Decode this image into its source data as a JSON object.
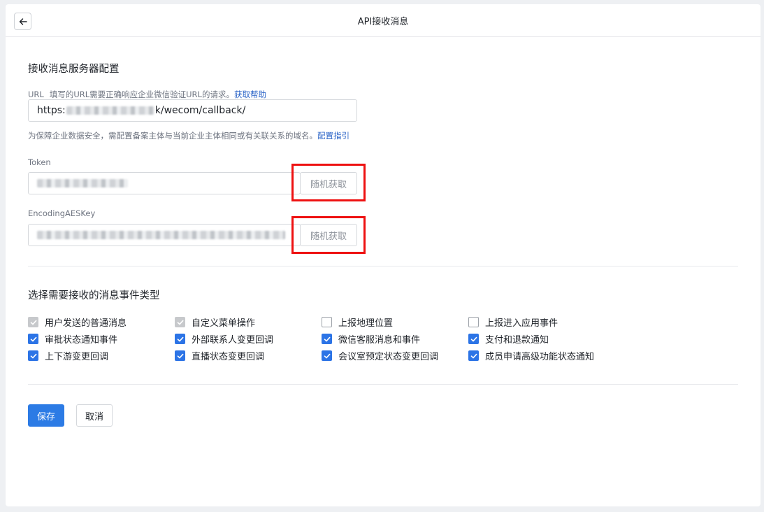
{
  "header": {
    "title": "API接收消息",
    "back_icon": "arrow-left-icon"
  },
  "server_config": {
    "section_title": "接收消息服务器配置",
    "url": {
      "label": "URL",
      "hint": "填写的URL需要正确响应企业微信验证URL的请求。",
      "help_link": "获取帮助",
      "value_prefix": "https:",
      "value_suffix": "k/wecom/callback/",
      "note": "为保障企业数据安全，需配置备案主体与当前企业主体相同或有关联关系的域名。",
      "note_link": "配置指引"
    },
    "token": {
      "label": "Token",
      "random_button": "随机获取"
    },
    "aes_key": {
      "label": "EncodingAESKey",
      "random_button": "随机获取"
    }
  },
  "events": {
    "section_title": "选择需要接收的消息事件类型",
    "items": [
      {
        "label": "用户发送的普通消息",
        "state": "disabled"
      },
      {
        "label": "自定义菜单操作",
        "state": "disabled"
      },
      {
        "label": "上报地理位置",
        "state": "unchecked"
      },
      {
        "label": "上报进入应用事件",
        "state": "unchecked"
      },
      {
        "label": "审批状态通知事件",
        "state": "checked"
      },
      {
        "label": "外部联系人变更回调",
        "state": "checked"
      },
      {
        "label": "微信客服消息和事件",
        "state": "checked"
      },
      {
        "label": "支付和退款通知",
        "state": "checked"
      },
      {
        "label": "上下游变更回调",
        "state": "checked"
      },
      {
        "label": "直播状态变更回调",
        "state": "checked"
      },
      {
        "label": "会议室预定状态变更回调",
        "state": "checked"
      },
      {
        "label": "成员申请高级功能状态通知",
        "state": "checked"
      }
    ]
  },
  "actions": {
    "save": "保存",
    "cancel": "取消"
  },
  "colors": {
    "primary": "#2c7be5",
    "checkbox_checked": "#2c74e6",
    "highlight_border": "#ee1111",
    "link": "#2b64c7"
  }
}
